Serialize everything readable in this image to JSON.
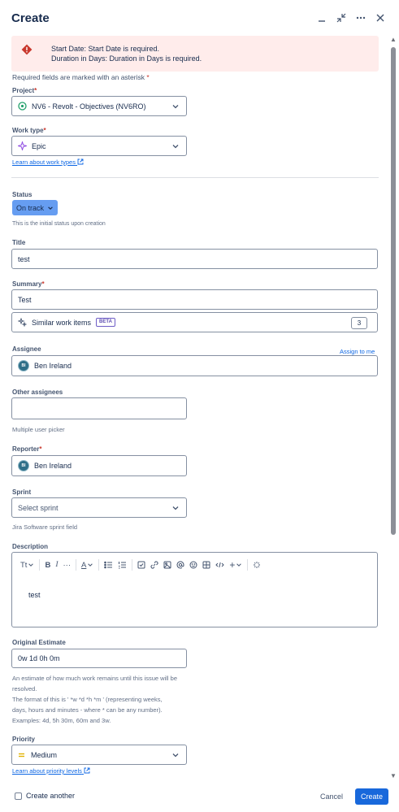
{
  "header": {
    "title": "Create"
  },
  "errors": [
    "Start Date: Start Date is required.",
    "Duration in Days: Duration in Days is required."
  ],
  "required_note": "Required fields are marked with an asterisk",
  "required_star": "*",
  "project": {
    "label": "Project",
    "value": "NV6 - Revolt - Objectives (NV6RO)"
  },
  "work_type": {
    "label": "Work type",
    "value": "Epic",
    "link": "Learn about work types"
  },
  "status": {
    "label": "Status",
    "value": "On track",
    "help": "This is the initial status upon creation"
  },
  "title_field": {
    "label": "Title",
    "value": "test"
  },
  "summary": {
    "label": "Summary",
    "value": "Test",
    "similar_label": "Similar work items",
    "beta": "BETA",
    "similar_count": "3"
  },
  "assignee": {
    "label": "Assignee",
    "assign_to_me": "Assign to me",
    "value": "Ben Ireland",
    "initials": "BI"
  },
  "other_assignees": {
    "label": "Other assignees",
    "value": "",
    "help": "Multiple user picker"
  },
  "reporter": {
    "label": "Reporter",
    "value": "Ben Ireland",
    "initials": "BI"
  },
  "sprint": {
    "label": "Sprint",
    "placeholder": "Select sprint",
    "help": "Jira Software sprint field"
  },
  "description": {
    "label": "Description",
    "toolbar": {
      "text_style": "Tt",
      "bold": "B",
      "italic": "I",
      "more": "···",
      "color": "A",
      "plus": "+"
    },
    "content": "test"
  },
  "original_estimate": {
    "label": "Original Estimate",
    "value": "0w 1d 0h 0m",
    "help": [
      "An estimate of how much work remains until this issue will be",
      "resolved.",
      "The format of this is ' *w *d *h *m ' (representing weeks,",
      "days, hours and minutes - where * can be any number).",
      "Examples: 4d, 5h 30m, 60m and 3w."
    ]
  },
  "priority": {
    "label": "Priority",
    "value": "Medium",
    "link": "Learn about priority levels"
  },
  "footer": {
    "create_another": "Create another",
    "cancel": "Cancel",
    "create": "Create"
  },
  "colors": {
    "error_bg": "#ffeceb",
    "status_bg": "#669df1",
    "primary": "#1868db",
    "epic": "#904ee2",
    "priority_medium": "#e2b203"
  }
}
